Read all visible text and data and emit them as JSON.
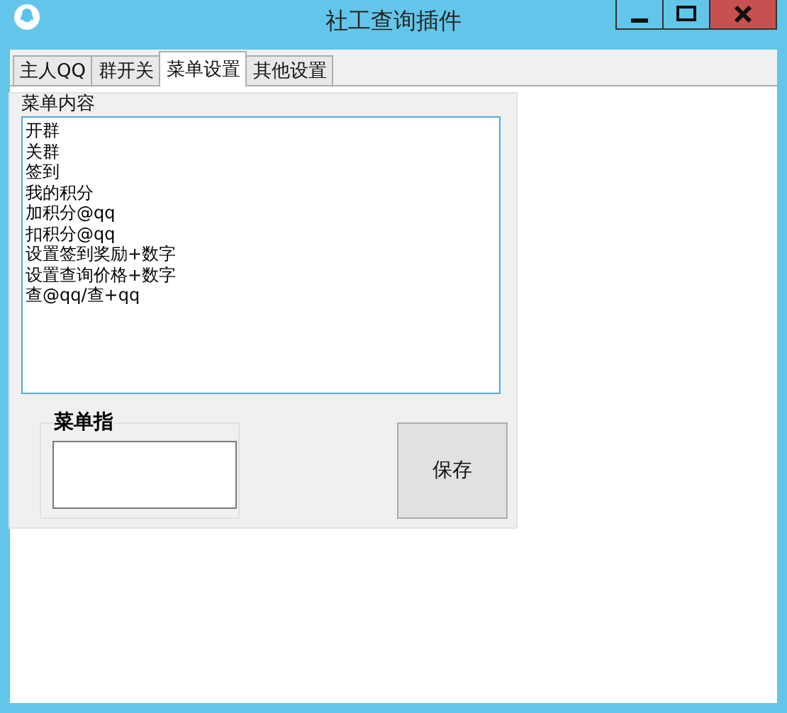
{
  "window": {
    "title": "社工查询插件"
  },
  "tabs": [
    {
      "label": "主人QQ",
      "selected": false
    },
    {
      "label": "群开关",
      "selected": false
    },
    {
      "label": "菜单设置",
      "selected": true
    },
    {
      "label": "其他设置",
      "selected": false
    }
  ],
  "menu_group": {
    "title": "菜单内容",
    "lines": [
      "开群",
      "关群",
      "签到",
      "我的积分",
      "加积分@qq",
      "扣积分@qq",
      "设置签到奖励+数字",
      "设置查询价格+数字",
      "查@qq/查+qq"
    ]
  },
  "command_group": {
    "title": "菜单指"
  },
  "save_button": {
    "label": "保存"
  }
}
